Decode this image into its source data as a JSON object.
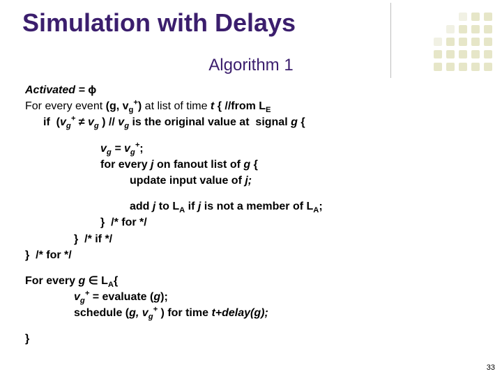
{
  "title": "Simulation with Delays",
  "subtitle": "Algorithm 1",
  "page_number": "33",
  "lines": {
    "l1a": "Activated = ",
    "l1sym": "ϕ",
    "l2a": "For every event ",
    "l2b": "(g, v",
    "l2c": ")",
    "l2d": " at list of time ",
    "l2e": "t",
    "l2f": " { ",
    "l2g": "//from L",
    "l2gsub": "E",
    "l3a": "if  (",
    "l3b": "v",
    "l3c": " ≠ ",
    "l3d": "v",
    "l3e": " ) // ",
    "l3f": "v",
    "l3g": " is the original value at  signal ",
    "l3h": "g",
    "l3i": " {",
    "l5a": "v",
    "l5b": " = v",
    "l5c": ";",
    "l6a": "for every ",
    "l6b": "j",
    "l6c": " on fanout list of ",
    "l6d": "g",
    "l6e": " {",
    "l7a": "update input value of ",
    "l7b": "j;",
    "l9a": "add ",
    "l9b": "j",
    "l9c": " to ",
    "l9d": "L",
    "l9e": " if ",
    "l9f": "j",
    "l9g": " is not a member of ",
    "l9h": "L",
    "l9i": ";",
    "l10": "}  /* for */",
    "l11": "}  /* if */",
    "l12": "}  /* for */",
    "l14a": "For every ",
    "l14b": "g",
    "l14c": " ∈ ",
    "l14d": "L",
    "l14e": "{",
    "l15a": "v",
    "l15b": " = evaluate (",
    "l15c": "g",
    "l15d": ");",
    "l16a": "schedule (",
    "l16b": "g, v",
    "l16c": " ) for time ",
    "l16d": "t+delay(g);",
    "l18": "}",
    "sub_g": "g",
    "sub_A": "A",
    "sup_plus": "+"
  }
}
